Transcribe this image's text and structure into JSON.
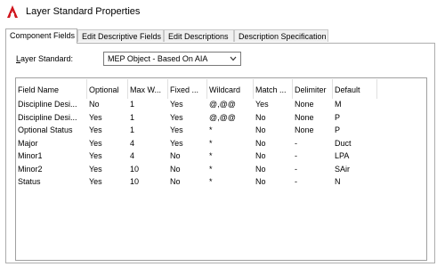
{
  "window": {
    "title": "Layer Standard Properties",
    "app_icon": "autocad-logo-icon"
  },
  "tabs": [
    {
      "label": "Component Fields",
      "active": true
    },
    {
      "label": "Edit Descriptive Fields",
      "active": false
    },
    {
      "label": "Edit Descriptions",
      "active": false
    },
    {
      "label": "Description Specification",
      "active": false
    }
  ],
  "layer_standard": {
    "label_underlined": "L",
    "label_rest": "ayer Standard:",
    "selected": "MEP Object - Based On AIA"
  },
  "table": {
    "columns": [
      "Field Name",
      "Optional",
      "Max W...",
      "Fixed ...",
      "Wildcard",
      "Match ...",
      "Delimiter",
      "Default"
    ],
    "rows": [
      [
        "Discipline Desi...",
        "No",
        "1",
        "Yes",
        "@,@@",
        "Yes",
        "None",
        "M"
      ],
      [
        "Discipline Desi...",
        "Yes",
        "1",
        "Yes",
        "@,@@",
        "No",
        "None",
        "P"
      ],
      [
        "Optional Status",
        "Yes",
        "1",
        "Yes",
        "*",
        "No",
        "None",
        "P"
      ],
      [
        "Major",
        "Yes",
        "4",
        "Yes",
        "*",
        "No",
        "-",
        "Duct"
      ],
      [
        "Minor1",
        "Yes",
        "4",
        "No",
        "*",
        "No",
        "-",
        "LPA"
      ],
      [
        "Minor2",
        "Yes",
        "10",
        "No",
        "*",
        "No",
        "-",
        "SAir"
      ],
      [
        "Status",
        "Yes",
        "10",
        "No",
        "*",
        "No",
        "-",
        "N"
      ]
    ]
  }
}
